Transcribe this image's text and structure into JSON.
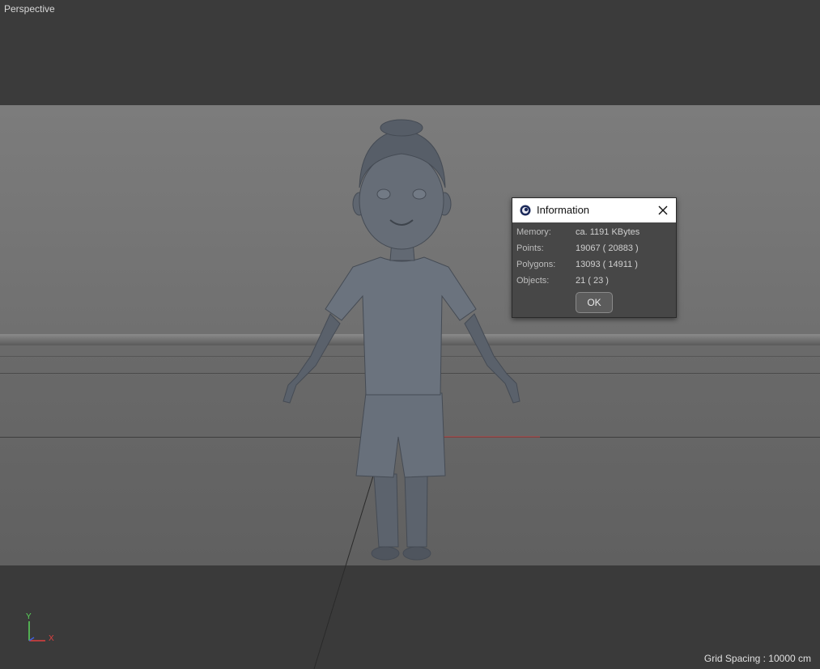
{
  "viewport": {
    "camera_label": "Perspective",
    "grid_spacing": "Grid Spacing : 10000 cm"
  },
  "axes": {
    "y_label": "Y",
    "x_label": "X"
  },
  "dialog": {
    "title": "Information",
    "rows": [
      {
        "label": "Memory:",
        "value": "ca. 1191 KBytes"
      },
      {
        "label": "Points:",
        "value": "19067 ( 20883 )"
      },
      {
        "label": "Polygons:",
        "value": "13093 ( 14911 )"
      },
      {
        "label": "Objects:",
        "value": "21 ( 23 )"
      }
    ],
    "ok_label": "OK"
  },
  "colors": {
    "axis_x": "#e04040",
    "axis_y": "#5ad65a",
    "dialog_bg": "#474747",
    "titlebar_bg": "#ffffff"
  }
}
